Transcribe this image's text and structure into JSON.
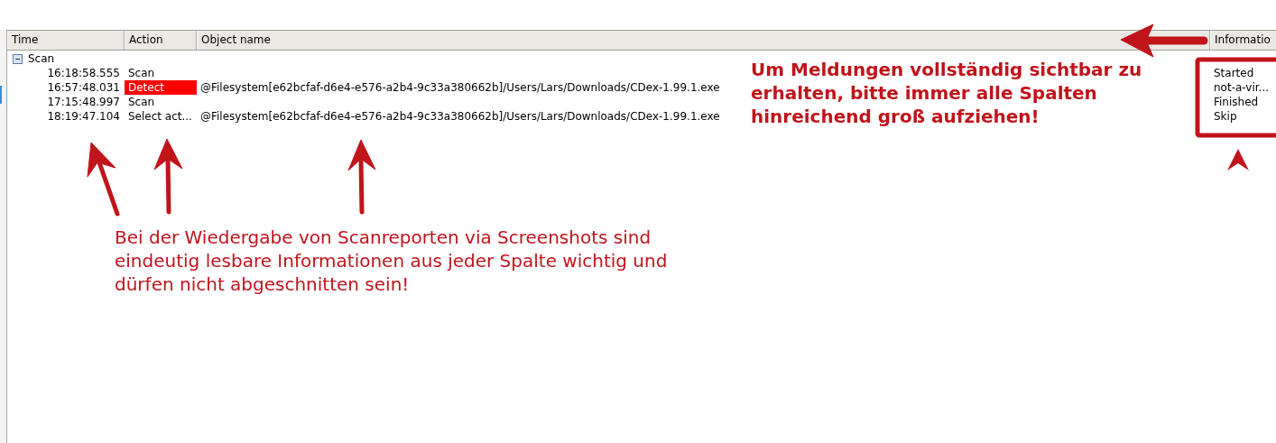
{
  "table": {
    "columns": [
      "Time",
      "Action",
      "Object name",
      "Informatio"
    ],
    "group": {
      "label": "Scan",
      "expanded": true,
      "rows": [
        {
          "time": "16:18:58.555",
          "action": "Scan",
          "object": "",
          "information": "Started",
          "highlighted": false
        },
        {
          "time": "16:57:48.031",
          "action": "Detect",
          "object": "@Filesystem[e62bcfaf-d6e4-e576-a2b4-9c33a380662b]/Users/Lars/Downloads/CDex-1.99.1.exe",
          "information": "not-a-vir...",
          "highlighted": true
        },
        {
          "time": "17:15:48.997",
          "action": "Scan",
          "object": "",
          "information": "Finished",
          "highlighted": false
        },
        {
          "time": "18:19:47.104",
          "action": "Select act...",
          "object": "@Filesystem[e62bcfaf-d6e4-e576-a2b4-9c33a380662b]/Users/Lars/Downloads/CDex-1.99.1.exe",
          "information": "Skip",
          "highlighted": false
        }
      ]
    }
  },
  "annotations": {
    "top_note": "Um Meldungen vollständig sichtbar zu erhalten, bitte immer alle Spalten hinreichend groß aufziehen!",
    "bottom_note": "Bei der Wiedergabe von Scanreporten via Screenshots sind eindeutig lesbare Informationen aus jeder Spalte wichtig und dürfen nicht abgeschnitten sein!"
  }
}
